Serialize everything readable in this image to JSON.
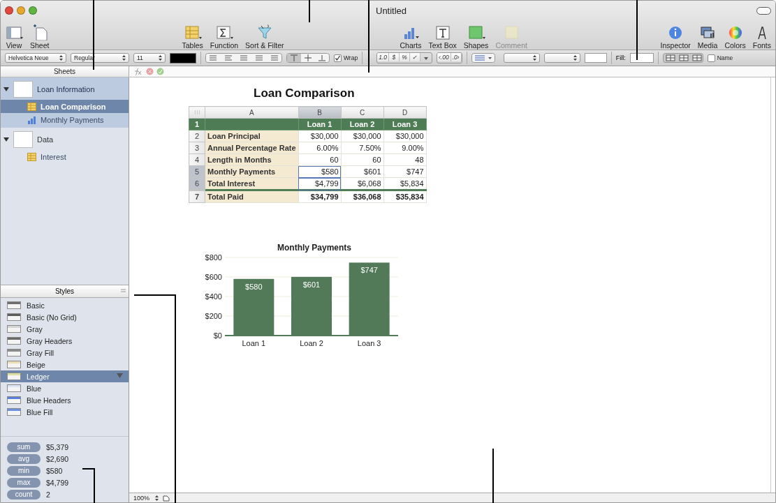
{
  "window": {
    "title": "Untitled"
  },
  "toolbar": {
    "left": [
      {
        "kind": "view",
        "label": "View",
        "disabled": false
      },
      {
        "kind": "sheet",
        "label": "Sheet",
        "disabled": false
      }
    ],
    "center": [
      {
        "kind": "tables",
        "label": "Tables",
        "disabled": false
      },
      {
        "kind": "function",
        "label": "Function",
        "disabled": false
      },
      {
        "kind": "filter",
        "label": "Sort & Filter",
        "disabled": false
      }
    ],
    "insert": [
      {
        "kind": "charts",
        "label": "Charts",
        "disabled": false
      },
      {
        "kind": "textbox",
        "label": "Text Box",
        "disabled": false
      },
      {
        "kind": "shapes",
        "label": "Shapes",
        "disabled": false
      },
      {
        "kind": "comment",
        "label": "Comment",
        "disabled": true
      }
    ],
    "right": [
      {
        "kind": "inspector",
        "label": "Inspector",
        "disabled": false
      },
      {
        "kind": "media",
        "label": "Media",
        "disabled": false
      },
      {
        "kind": "colors",
        "label": "Colors",
        "disabled": false
      },
      {
        "kind": "fonts",
        "label": "Fonts",
        "disabled": false
      }
    ]
  },
  "format_bar": {
    "font": "Helvetica Neue",
    "style": "Regular",
    "size": "11",
    "wrap": {
      "label": "Wrap",
      "checked": true
    },
    "number_buttons": [
      "1.0",
      "$",
      "%",
      "✓"
    ],
    "decimal_buttons": [
      "‹.00",
      ".0›"
    ],
    "fill_label": "Fill:",
    "name_toggle": {
      "label": "Name",
      "checked": false
    }
  },
  "sidebar": {
    "sheets_header": "Sheets",
    "sheets": [
      {
        "label": "Loan Information",
        "expanded": true,
        "selected": true,
        "children": [
          {
            "kind": "table",
            "label": "Loan Comparison",
            "selected": true
          },
          {
            "kind": "chart",
            "label": "Monthly Payments",
            "selected": false
          }
        ]
      },
      {
        "label": "Data",
        "expanded": true,
        "selected": false,
        "children": [
          {
            "kind": "table",
            "label": "Interest",
            "selected": false
          }
        ]
      }
    ],
    "styles_header": "Styles",
    "styles": [
      {
        "label": "Basic",
        "color": "#6e6e6e",
        "selected": false
      },
      {
        "label": "Basic (No Grid)",
        "color": "#5c5c5c",
        "selected": false
      },
      {
        "label": "Gray",
        "color": "#d4d4d4",
        "selected": false
      },
      {
        "label": "Gray Headers",
        "color": "#6a6a6a",
        "selected": false
      },
      {
        "label": "Gray Fill",
        "color": "#8a8a8a",
        "selected": false
      },
      {
        "label": "Beige",
        "color": "#eadcb4",
        "selected": false
      },
      {
        "label": "Ledger",
        "color": "#d9e0a0",
        "selected": true
      },
      {
        "label": "Blue",
        "color": "#dde5f4",
        "selected": false
      },
      {
        "label": "Blue Headers",
        "color": "#5a7fd8",
        "selected": false
      },
      {
        "label": "Blue Fill",
        "color": "#6d8fde",
        "selected": false
      }
    ],
    "stats": [
      {
        "label": "sum",
        "value": "$5,379"
      },
      {
        "label": "avg",
        "value": "$2,690"
      },
      {
        "label": "min",
        "value": "$580"
      },
      {
        "label": "max",
        "value": "$4,799"
      },
      {
        "label": "count",
        "value": "2"
      }
    ]
  },
  "table": {
    "title": "Loan Comparison",
    "columns": [
      {
        "label": "A",
        "selected": false
      },
      {
        "label": "B",
        "selected": true
      },
      {
        "label": "C",
        "selected": false
      },
      {
        "label": "D",
        "selected": false
      }
    ],
    "rows": [
      {
        "number": "1",
        "kind": "header",
        "selected": false,
        "cells": [
          "",
          "Loan 1",
          "Loan 2",
          "Loan 3"
        ]
      },
      {
        "number": "2",
        "kind": "body",
        "selected": false,
        "cells": [
          "Loan Principal",
          "$30,000",
          "$30,000",
          "$30,000"
        ]
      },
      {
        "number": "3",
        "kind": "body",
        "selected": false,
        "cells": [
          "Annual Percentage Rate",
          "6.00%",
          "7.50%",
          "9.00%"
        ]
      },
      {
        "number": "4",
        "kind": "body",
        "selected": false,
        "cells": [
          "Length in Months",
          "60",
          "60",
          "48"
        ]
      },
      {
        "number": "5",
        "kind": "body",
        "selected": true,
        "cells": [
          "Monthly Payments",
          "$580",
          "$601",
          "$747"
        ]
      },
      {
        "number": "6",
        "kind": "body",
        "selected": true,
        "cells": [
          "Total Interest",
          "$4,799",
          "$6,068",
          "$5,834"
        ]
      },
      {
        "number": "7",
        "kind": "footer",
        "selected": false,
        "cells": [
          "Total Paid",
          "$34,799",
          "$36,068",
          "$35,834"
        ]
      }
    ]
  },
  "chart": {
    "chart_data": {
      "type": "bar",
      "title": "Monthly Payments",
      "categories": [
        "Loan 1",
        "Loan 2",
        "Loan 3"
      ],
      "series": [
        {
          "color": "#527a58",
          "values": [
            580,
            601,
            747
          ]
        }
      ],
      "grid": true,
      "ylim": [
        0,
        800
      ],
      "yticks": [
        {
          "value": 0,
          "label": "$0"
        },
        {
          "value": 200,
          "label": "$200"
        },
        {
          "value": 400,
          "label": "$400"
        },
        {
          "value": 600,
          "label": "$600"
        },
        {
          "value": 800,
          "label": "$800"
        }
      ],
      "value_labels": [
        "$580",
        "$601",
        "$747"
      ]
    }
  },
  "status_bar": {
    "zoom": "100%"
  }
}
